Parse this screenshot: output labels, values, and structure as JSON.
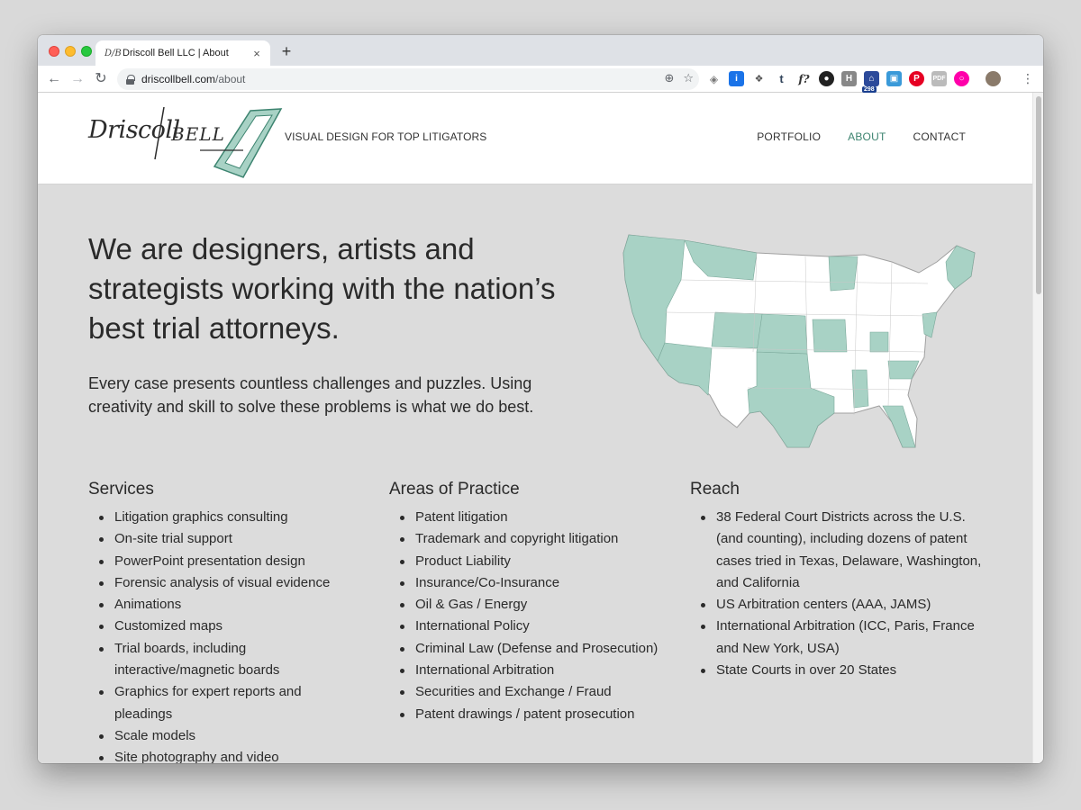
{
  "browser": {
    "tab_title": "Driscoll Bell LLC | About",
    "tab_favicon": "D/B",
    "new_tab": "+",
    "url_host": "driscollbell.com",
    "url_path": "/about",
    "extension_badge": "298"
  },
  "header": {
    "logo_driscoll": "Driscoll",
    "logo_bell": "BELL",
    "tagline": "VISUAL DESIGN FOR TOP LITIGATORS",
    "nav": [
      "PORTFOLIO",
      "ABOUT",
      "CONTACT"
    ],
    "active_nav": "ABOUT"
  },
  "hero": {
    "title": "We are designers, artists and strategists working with the nation’s best trial attorneys.",
    "subtitle": "Every case presents countless challenges and puzzles. Using creativity and skill to solve these problems is what we do best."
  },
  "sections": {
    "services": {
      "heading": "Services",
      "items": [
        "Litigation graphics consulting",
        "On-site trial support",
        "PowerPoint presentation design",
        "Forensic analysis of visual evidence",
        "Animations",
        "Customized maps",
        "Trial boards, including interactive/magnetic boards",
        "Graphics for expert reports and pleadings",
        "Scale models",
        "Site photography and video"
      ]
    },
    "practice": {
      "heading": "Areas of Practice",
      "items": [
        "Patent litigation",
        "Trademark and copyright litigation",
        "Product Liability",
        "Insurance/Co-Insurance",
        "Oil & Gas / Energy",
        "International Policy",
        "Criminal Law (Defense and Prosecution)",
        "International Arbitration",
        "Securities and Exchange / Fraud",
        "Patent drawings / patent prosecution"
      ]
    },
    "reach": {
      "heading": "Reach",
      "items": [
        "38 Federal Court Districts across the U.S. (and counting), including dozens of patent cases tried in Texas, Delaware, Washington, and California",
        "US Arbitration centers (AAA, JAMS)",
        "International Arbitration (ICC, Paris, France and New York, USA)",
        "State Courts in over 20 States"
      ]
    }
  },
  "colors": {
    "accent": "#3d8470",
    "map_fill": "#a8d2c5",
    "page_bg": "#dcdcdc"
  },
  "icons": [
    "back-arrow-icon",
    "forward-arrow-icon",
    "reload-icon",
    "lock-icon",
    "zoom-icon",
    "star-icon",
    "menu-dots-icon",
    "tab-close-icon"
  ]
}
